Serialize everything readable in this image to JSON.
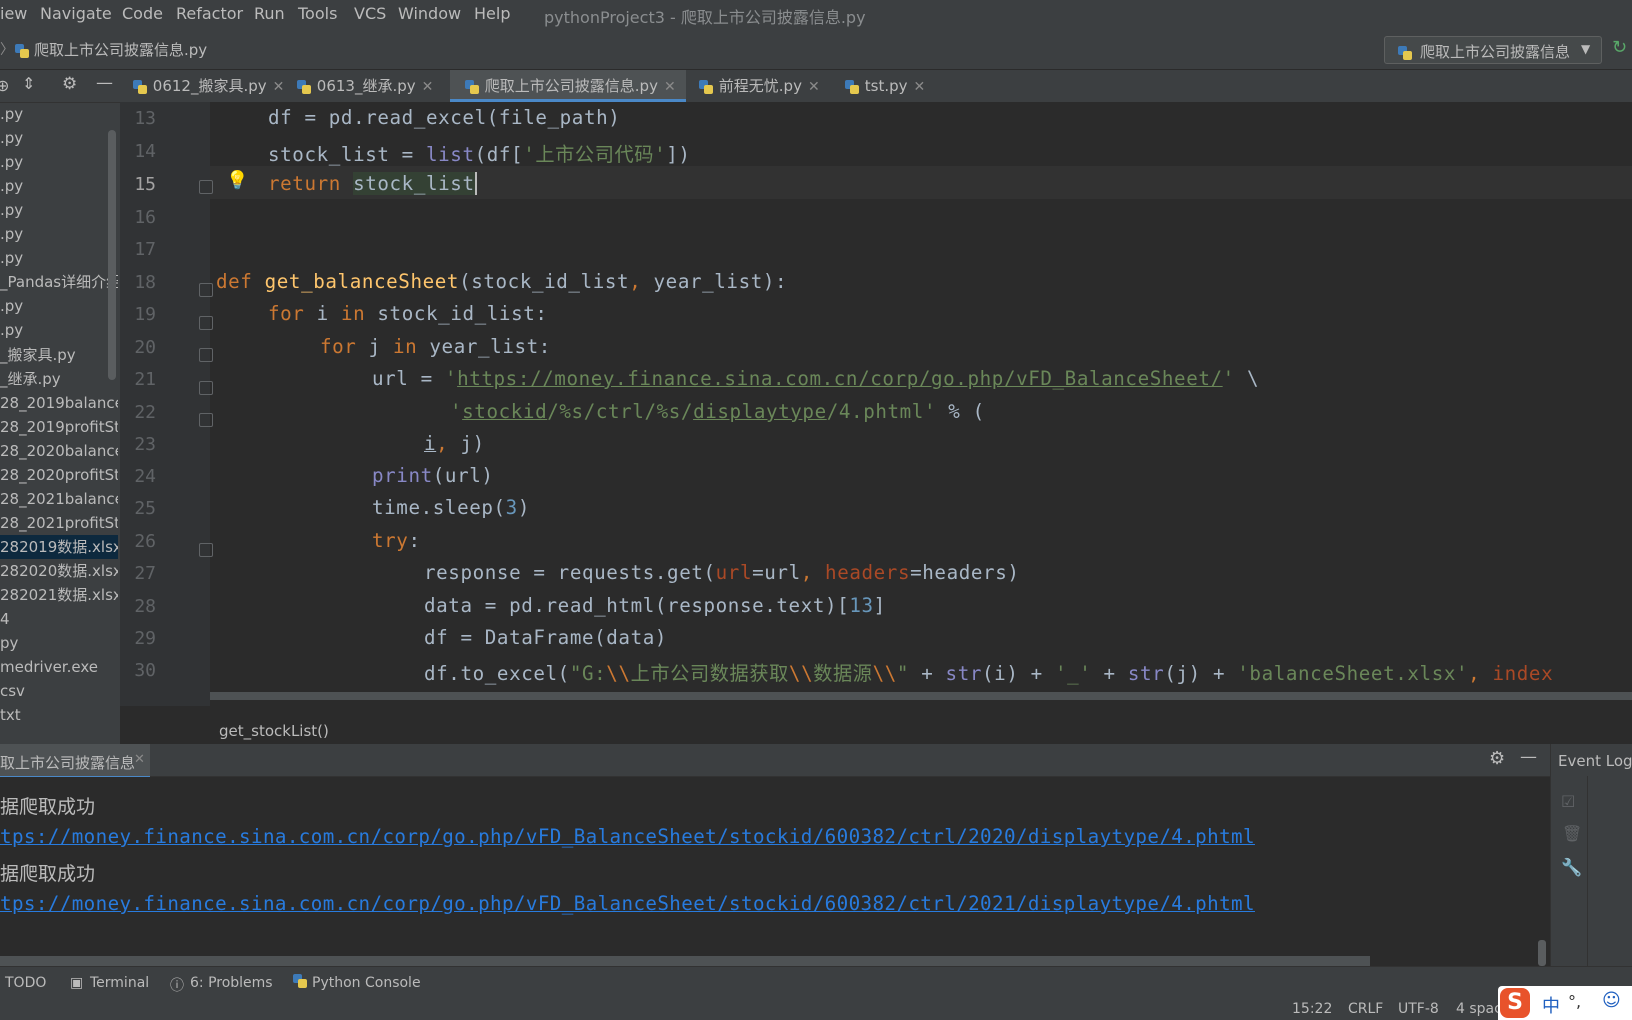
{
  "menu": [
    "iew",
    "Navigate",
    "Code",
    "Refactor",
    "Run",
    "Tools",
    "VCS",
    "Window",
    "Help"
  ],
  "window_title": "pythonProject3 - 爬取上市公司披露信息.py",
  "nav": {
    "file": "爬取上市公司披露信息.py",
    "run_config": "爬取上市公司披露信息"
  },
  "project_items": [
    ".py",
    ".py",
    ".py",
    ".py",
    ".py",
    ".py",
    ".py",
    "_Pandas详细介绍.",
    ".py",
    ".py",
    "_搬家具.py",
    "_继承.py",
    "28_2019balanceS",
    "28_2019profitSta",
    "28_2020balanceS",
    "28_2020profitSta",
    "28_2021balanceS",
    "28_2021profitSta",
    "282019数据.xlsx",
    "282020数据.xlsx",
    "282021数据.xlsx",
    "4",
    "py",
    "medriver.exe",
    "csv",
    "txt"
  ],
  "tabs": [
    "0612_搬家具.py",
    "0613_继承.py",
    "爬取上市公司披露信息.py",
    "前程无忧.py",
    "tst.py"
  ],
  "line_numbers": [
    "13",
    "14",
    "15",
    "16",
    "17",
    "18",
    "19",
    "20",
    "21",
    "22",
    "23",
    "24",
    "25",
    "26",
    "27",
    "28",
    "29",
    "30"
  ],
  "code": {
    "l13": "df = pd.read_excel(file_path)",
    "l14a": "stock_list = ",
    "l14b": "list",
    "l14c": "(df[",
    "l14d": "'上市公司代码'",
    "l14e": "])",
    "l15a": "return",
    "l15b": "stock_list",
    "l18a": "def",
    "l18b": "get_balanceSheet",
    "l18c": "(stock_id_list",
    "l18d": ",",
    "l18e": " year_list):",
    "l19a": "for",
    "l19b": " i ",
    "l19c": "in",
    "l19d": " stock_id_list:",
    "l20a": "for",
    "l20b": " j ",
    "l20c": "in",
    "l20d": " year_list:",
    "l21a": "url = ",
    "l21b": "'",
    "l21c": "https://money.finance.sina.com.cn/corp/go.php/vFD_BalanceSheet/",
    "l21d": "'",
    "l21e": " \\",
    "l22a": "'",
    "l22b": "stockid",
    "l22c": "/%s/ctrl/%s/",
    "l22d": "displaytype",
    "l22e": "/4.phtml'",
    "l22f": " % (",
    "l23a": "i",
    "l23b": ",",
    "l23c": " j)",
    "l24a": "print",
    "l24b": "(url)",
    "l25a": "time.sleep(",
    "l25b": "3",
    "l25c": ")",
    "l26a": "try",
    "l26b": ":",
    "l27a": "response = requests.get(",
    "l27b": "url",
    "l27c": "=url",
    "l27d": ", ",
    "l27e": "headers",
    "l27f": "=headers)",
    "l28a": "data = pd.read_html(response.text)[",
    "l28b": "13",
    "l28c": "]",
    "l29": "df = DataFrame(data)",
    "l30a": "df.to_excel(",
    "l30b": "\"G:",
    "l30c": "\\\\",
    "l30d": "上市公司数据获取",
    "l30e": "\\\\",
    "l30f": "数据源",
    "l30g": "\\\\",
    "l30h": "\"",
    "l30i": " + ",
    "l30j": "str",
    "l30k": "(i) + ",
    "l30l": "'_'",
    "l30m": " + ",
    "l30n": "str",
    "l30o": "(j) + ",
    "l30p": "'balanceSheet.xlsx'",
    "l30q": ", ",
    "l30r": "index"
  },
  "breadcrumb": "get_stockList()",
  "run": {
    "tab_label": "取上市公司披露信息",
    "event_log": "Event Log",
    "lines": [
      {
        "type": "txt",
        "text": "据爬取成功"
      },
      {
        "type": "link",
        "text": "tps://money.finance.sina.com.cn/corp/go.php/vFD_BalanceSheet/stockid/600382/ctrl/2020/displaytype/4.phtml"
      },
      {
        "type": "txt",
        "text": "据爬取成功"
      },
      {
        "type": "link",
        "text": "tps://money.finance.sina.com.cn/corp/go.php/vFD_BalanceSheet/stockid/600382/ctrl/2021/displaytype/4.phtml"
      }
    ]
  },
  "bottom_tools": [
    "TODO",
    "Terminal",
    "6: Problems",
    "Python Console"
  ],
  "status": {
    "position": "15:22",
    "line_sep": "CRLF",
    "encoding": "UTF-8",
    "indent": "4 spac"
  },
  "ime": {
    "lang": "中",
    "punct": "°,"
  }
}
